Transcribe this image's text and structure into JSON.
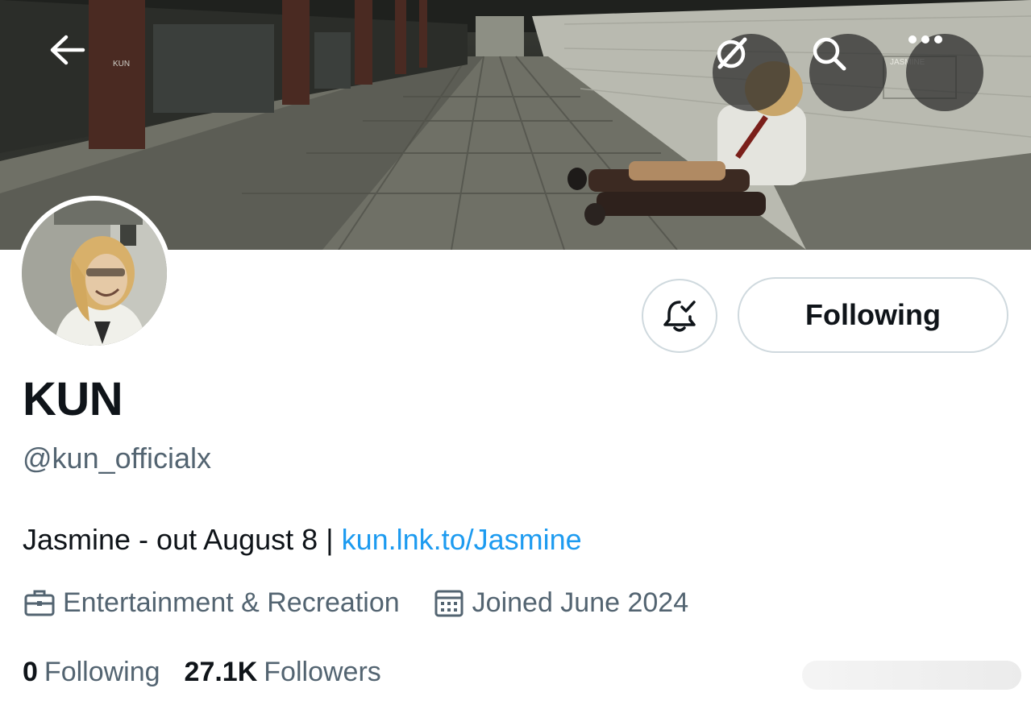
{
  "banner": {
    "back_label": "Back",
    "overlay_text_left": "KUN",
    "overlay_text_right": "JASMINE"
  },
  "profile": {
    "display_name": "KUN",
    "handle": "@kun_officialx",
    "bio_text": "Jasmine - out August 8 | ",
    "bio_link": "kun.lnk.to/Jasmine",
    "category": "Entertainment & Recreation",
    "joined": "Joined June 2024"
  },
  "actions": {
    "following_label": "Following"
  },
  "stats": {
    "following_count": "0",
    "following_label": "Following",
    "followers_count": "27.1K",
    "followers_label": "Followers"
  },
  "icons": {
    "back": "arrow-left-icon",
    "grok": "slash-circle-icon",
    "search": "search-icon",
    "more": "more-icon",
    "notify": "bell-check-icon",
    "category": "briefcase-icon",
    "joined": "calendar-icon"
  },
  "colors": {
    "link": "#1d9bf0",
    "secondary_text": "#536471",
    "primary_text": "#0f1419",
    "border": "#cfd9de"
  }
}
